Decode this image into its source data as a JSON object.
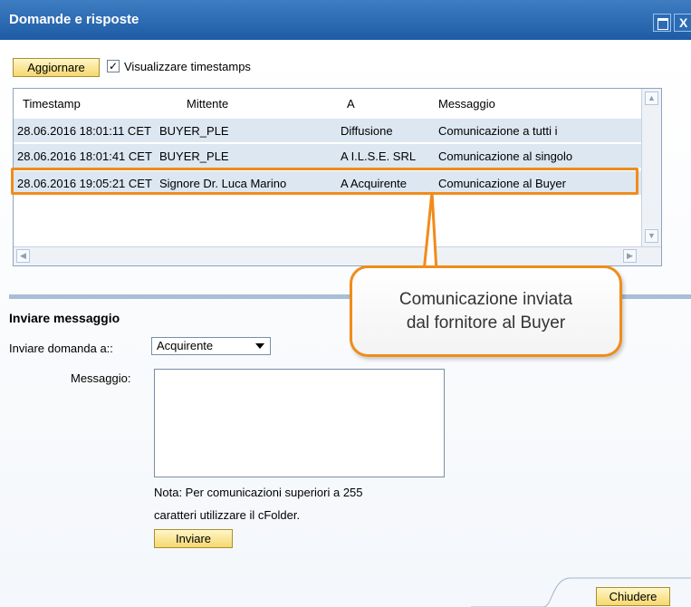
{
  "window": {
    "title": "Domande e risposte"
  },
  "toolbar": {
    "refresh_label": "Aggiornare",
    "timestamps_label": "Visualizzare timestamps",
    "timestamps_checked": "✓"
  },
  "table": {
    "headers": [
      "Timestamp",
      "Mittente",
      "A",
      "Messaggio"
    ],
    "rows": [
      [
        "28.06.2016 18:01:11 CET",
        "BUYER_PLE",
        "Diffusione",
        "Comunicazione a tutti i"
      ],
      [
        "28.06.2016 18:01:41 CET",
        "BUYER_PLE",
        "A I.L.S.E. SRL",
        "Comunicazione al singolo"
      ],
      [
        "28.06.2016 19:05:21 CET",
        "Signore Dr. Luca Marino",
        "A Acquirente",
        "Comunicazione al Buyer"
      ]
    ]
  },
  "callout": {
    "line1": "Comunicazione inviata",
    "line2": "dal fornitore al Buyer"
  },
  "send": {
    "section_title": "Inviare messaggio",
    "recipient_label": "Inviare domanda a::",
    "recipient_value": "Acquirente",
    "message_label": "Messaggio:",
    "note_line1": "Nota: Per comunicazioni superiori a 255",
    "note_line2": "caratteri utilizzare il cFolder.",
    "send_label": "Inviare"
  },
  "footer": {
    "close_label": "Chiudere"
  },
  "colors": {
    "accent_orange": "#f08c1a",
    "title_blue": "#1d5ba5",
    "row_blue": "#dce7f2"
  }
}
